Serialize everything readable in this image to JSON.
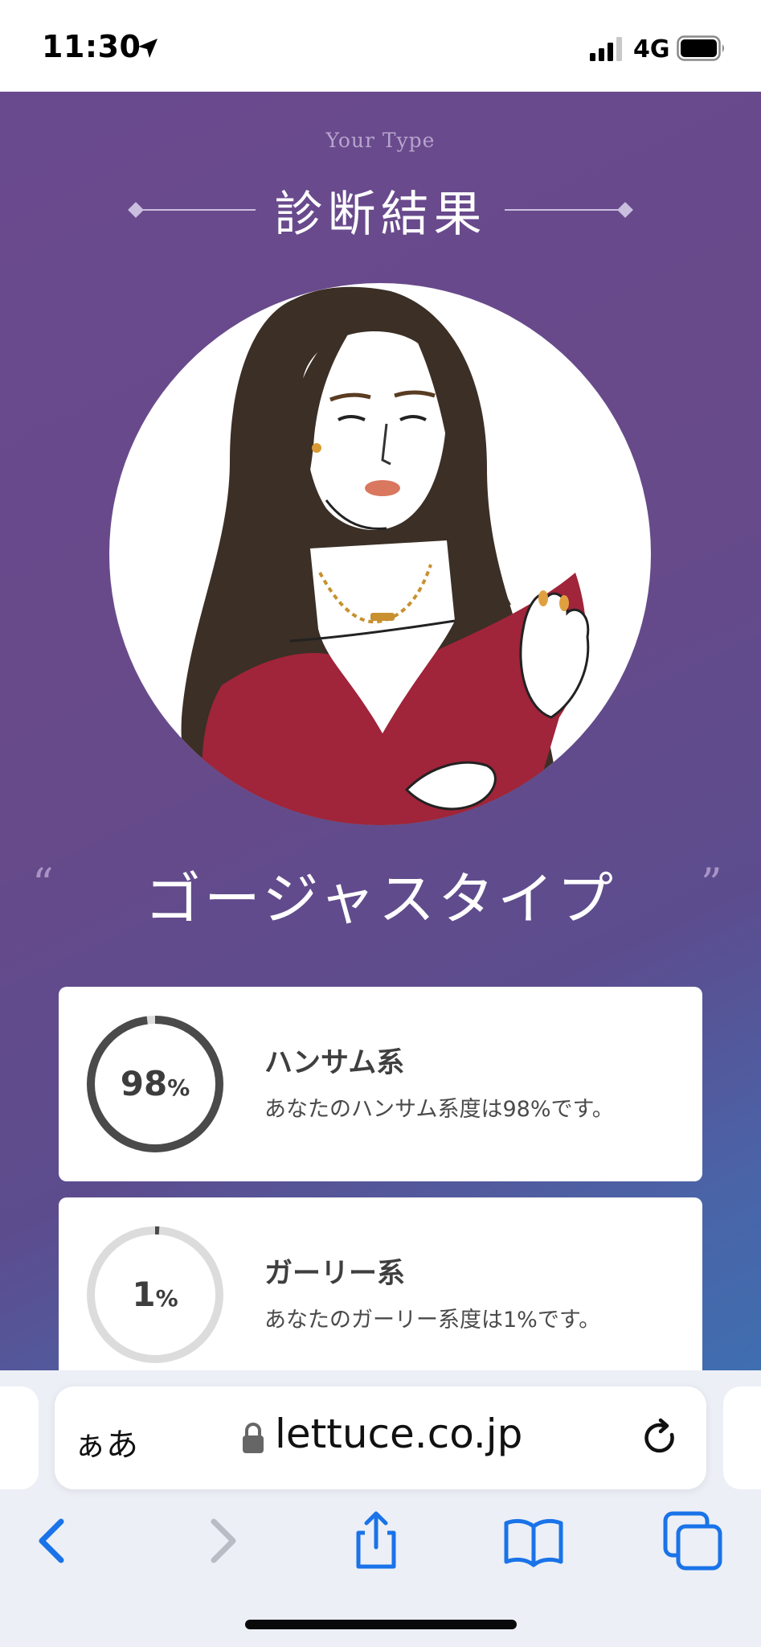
{
  "status_bar": {
    "time": "11:30",
    "network": "4G"
  },
  "page": {
    "subtitle": "Your Type",
    "title": "診断結果",
    "quote_open": "“",
    "quote_close": "”",
    "type_name": "ゴージャスタイプ",
    "results": [
      {
        "percent": 98,
        "percent_text": "98",
        "pct_sign": "%",
        "title": "ハンサム系",
        "description": "あなたのハンサム系度は98%です。"
      },
      {
        "percent": 1,
        "percent_text": "1",
        "pct_sign": "%",
        "title": "ガーリー系",
        "description": "あなたのガーリー系度は1%です。"
      }
    ]
  },
  "colors": {
    "ring_fill": "#4a4a4a",
    "ring_track": "#dcdcdc",
    "accent_blue": "#1a73e8"
  },
  "browser": {
    "text_size_button": "ぁあ",
    "url": "lettuce.co.jp"
  }
}
